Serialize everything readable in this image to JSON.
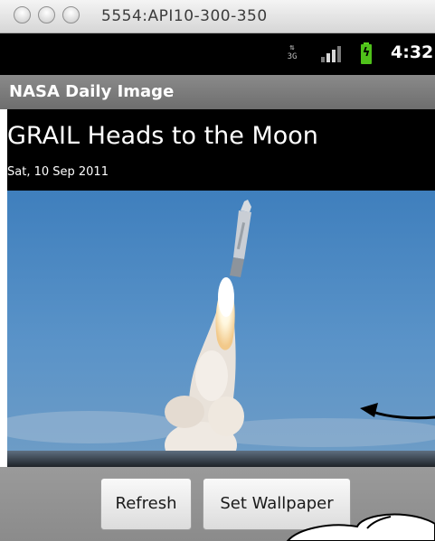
{
  "window": {
    "title": "5554:API10-300-350"
  },
  "status_bar": {
    "network_label": "3G",
    "time": "4:32",
    "icons": [
      "network-3g-icon",
      "signal-icon",
      "battery-charging-icon"
    ]
  },
  "app": {
    "title": "NASA Daily Image"
  },
  "content": {
    "headline": "GRAIL Heads to the Moon",
    "date": "Sat, 10 Sep 2011",
    "image_subject": "rocket-launch-image"
  },
  "buttons": {
    "refresh": "Refresh",
    "set_wallpaper": "Set Wallpaper"
  },
  "colors": {
    "status_bar": "#000000",
    "app_bar": "#7c7c7c",
    "button_bar": "#929292",
    "battery": "#4fc11a"
  }
}
